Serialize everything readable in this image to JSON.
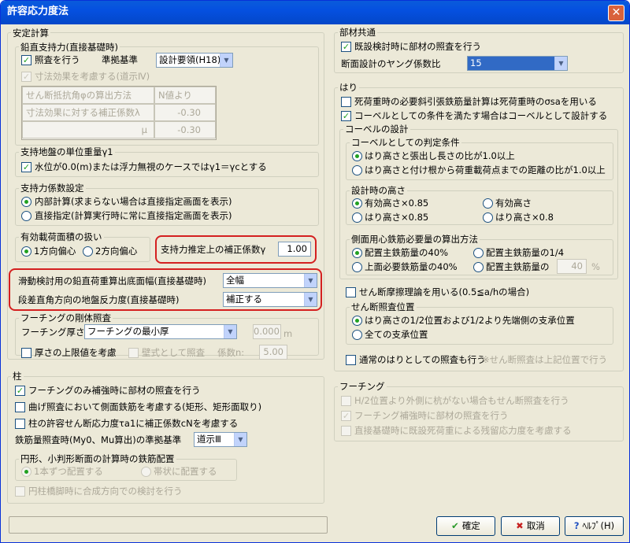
{
  "window": {
    "title": "許容応力度法"
  },
  "stability": {
    "title": "安定計算",
    "bearing": {
      "title": "鉛直支持力(直接基礎時)",
      "check_label": "照査を行う",
      "standard_label": "準拠基準",
      "standard_value": "設計要領(H18)",
      "size_effect_label": "寸法効果を考慮する(道示Ⅳ)",
      "grid": [
        {
          "label": "せん断抵抗角φの算出方法",
          "value": "N値より"
        },
        {
          "label": "寸法効果に対する補正係数λ",
          "value": "-0.30"
        },
        {
          "label": "μ",
          "value": "-0.30"
        }
      ]
    },
    "unit_weight": {
      "title": "支持地盤の単位重量γ1",
      "check_label": "水位が0.0(m)または浮力無視のケースではγ1＝γcとする"
    },
    "coef": {
      "title": "支持力係数設定",
      "opt1": "内部計算(求まらない場合は直接指定画面を表示)",
      "opt2": "直接指定(計算実行時に常に直接指定画面を表示)"
    },
    "eff_area": {
      "title": "有効載荷面積の扱い",
      "opt1": "1方向偏心",
      "opt2": "2方向偏心"
    },
    "correction": {
      "label": "支持力推定上の補正係数γ",
      "value": "1.00"
    },
    "sliding": {
      "label": "滑動検討用の鉛直荷重算出底面幅(直接基礎時)",
      "value": "全幅"
    },
    "step": {
      "label": "段差直角方向の地盤反力度(直接基礎時)",
      "value": "補正する"
    },
    "footing_rigid": {
      "title": "フーチングの剛体照査",
      "thickness_label": "フーチング厚さ",
      "thickness_value": "フーチングの最小厚",
      "thickness_num": "0.000",
      "thickness_unit": "m",
      "upper_label": "厚さの上限値を考慮",
      "wall_label": "壁式として照査",
      "coef_label": "係数n:",
      "coef_value": "5.00"
    }
  },
  "column": {
    "title": "柱",
    "c1": "フーチングのみ補強時に部材の照査を行う",
    "c2": "曲げ照査において側面鉄筋を考慮する(矩形、矩形面取り)",
    "c3": "柱の許容せん断応力度τa1に補正係数cNを考慮する",
    "rebar_label": "鉄筋量照査時(My0、Mu算出)の準拠基準",
    "rebar_value": "道示Ⅲ",
    "circ": {
      "title": "円形、小判形断面の計算時の鉄筋配置",
      "opt1": "1本ずつ配置する",
      "opt2": "帯状に配置する"
    },
    "c4": "円柱橋脚時に合成方向での検討を行う"
  },
  "common": {
    "title": "部材共通",
    "c1": "既設検討時に部材の照査を行う",
    "young_label": "断面設計のヤング係数比",
    "young_value": "15"
  },
  "beam": {
    "title": "はり",
    "c1": "死荷重時の必要斜引張鉄筋量計算は死荷重時のσsaを用いる",
    "c2": "コーベルとしての条件を満たす場合はコーベルとして設計する",
    "corbel": {
      "title": "コーベルの設計",
      "cond": {
        "title": "コーベルとしての判定条件",
        "opt1": "はり高さと張出し長さの比が1.0以上",
        "opt2": "はり高さと付け根から荷重載荷点までの距離の比が1.0以上"
      },
      "height": {
        "title": "設計時の高さ",
        "o1": "有効高さ×0.85",
        "o2": "有効高さ",
        "o3": "はり高さ×0.85",
        "o4": "はり高さ×0.8"
      },
      "side": {
        "title": "側面用心鉄筋必要量の算出方法",
        "o1": "配置主鉄筋量の40%",
        "o2": "配置主鉄筋量の1/4",
        "o3": "上面必要鉄筋量の40%",
        "o4": "配置主鉄筋量の",
        "num": "40",
        "unit": "%"
      }
    },
    "shear_theory": "せん断摩擦理論を用いる(0.5≦a/hの場合)",
    "shear_pos": {
      "title": "せん断照査位置",
      "opt1": "はり高さの1/2位置および1/2より先端側の支承位置",
      "opt2": "全ての支承位置"
    },
    "normal_check": "通常のはりとしての照査も行う",
    "normal_note": "※せん断照査は上記位置で行う"
  },
  "footing": {
    "title": "フーチング",
    "c1": "H/2位置より外側に杭がない場合もせん断照査を行う",
    "c2": "フーチング補強時に部材の照査を行う",
    "c3": "直接基礎時に既設死荷重による残留応力度を考慮する"
  },
  "buttons": {
    "ok": "確定",
    "cancel": "取消",
    "help": "ﾍﾙﾌﾟ(H)"
  }
}
